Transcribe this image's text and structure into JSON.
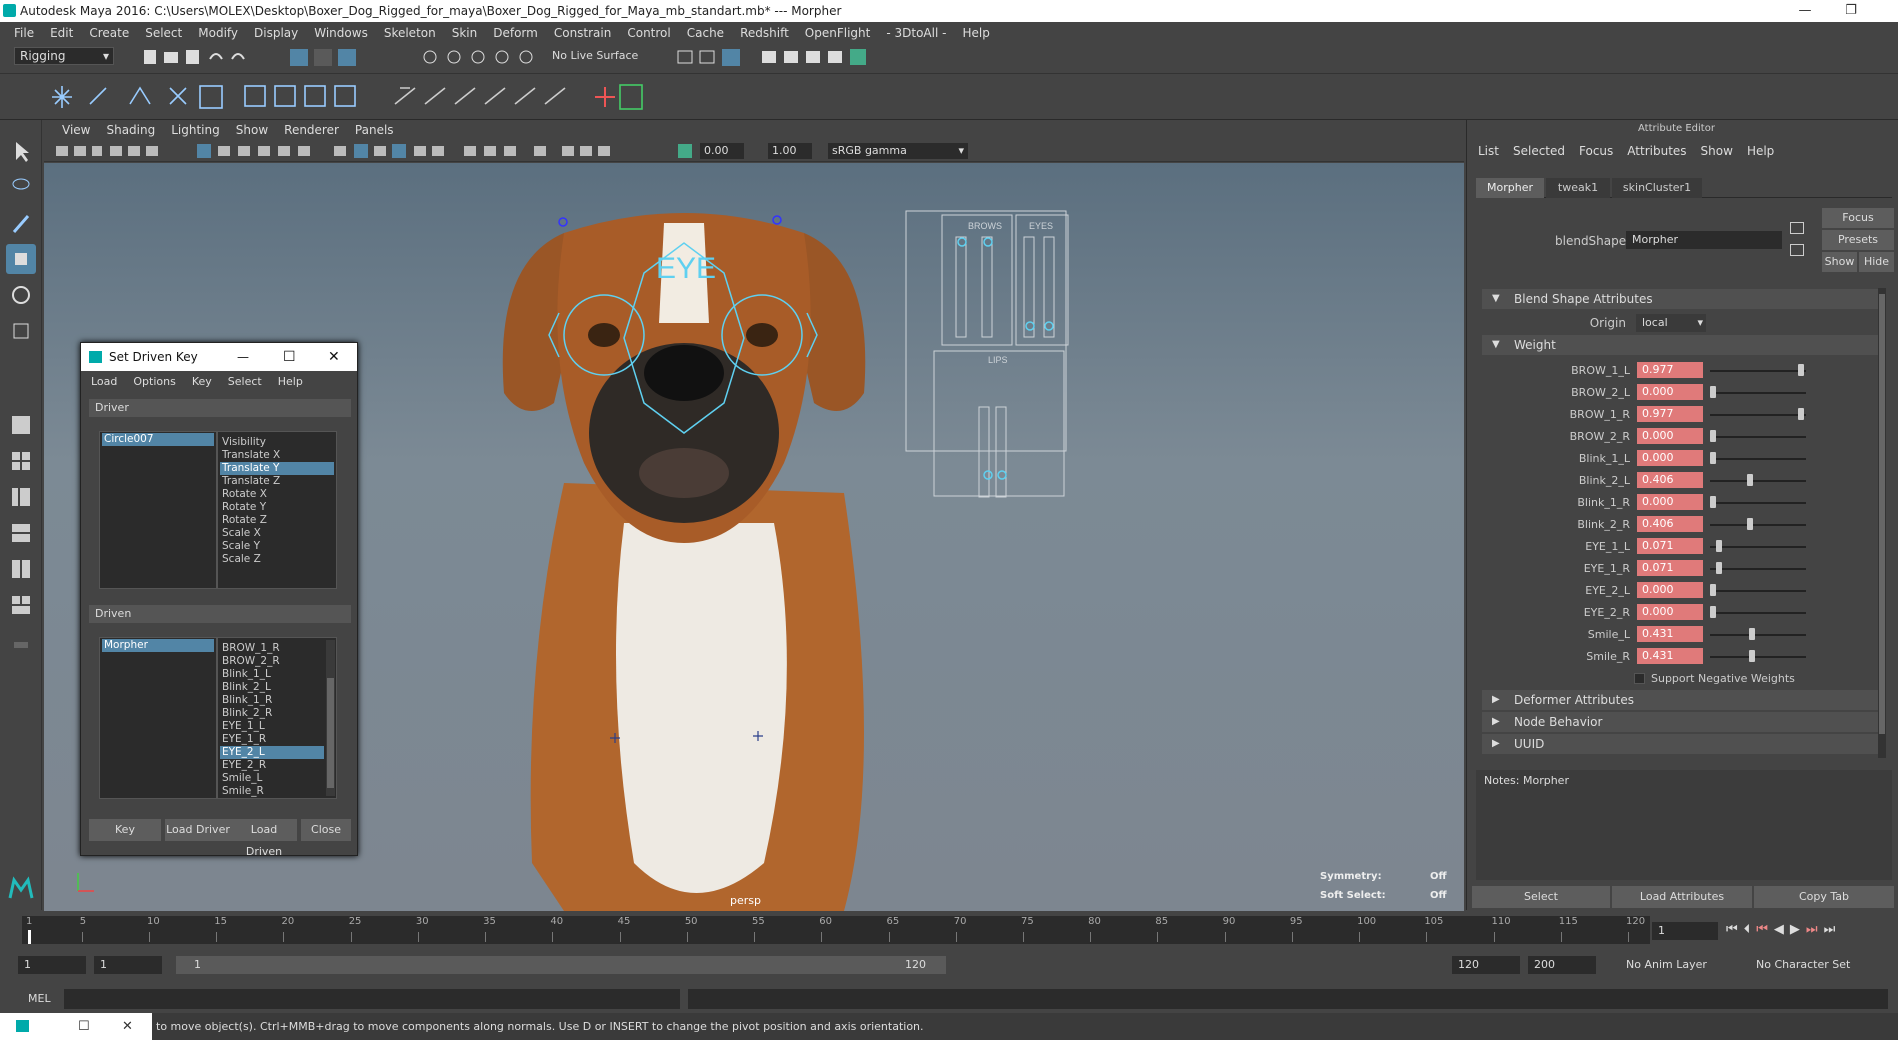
{
  "title_bar": {
    "text": "Autodesk Maya 2016: C:\\Users\\MOLEX\\Desktop\\Boxer_Dog_Rigged_for_maya\\Boxer_Dog_Rigged_for_Maya_mb_standart.mb*  ---  Morpher",
    "minimize": "—",
    "restore": "❐",
    "close": "✕"
  },
  "menubar": [
    "File",
    "Edit",
    "Create",
    "Select",
    "Modify",
    "Display",
    "Windows",
    "Skeleton",
    "Skin",
    "Deform",
    "Constrain",
    "Control",
    "Cache",
    "Redshift",
    "OpenFlight",
    "- 3DtoAll -",
    "Help"
  ],
  "shelf": {
    "mode": "Rigging",
    "live_surface": "No Live Surface"
  },
  "viewport": {
    "menu": [
      "View",
      "Shading",
      "Lighting",
      "Show",
      "Renderer",
      "Panels"
    ],
    "near": "0.00",
    "far": "1.00",
    "color_space": "sRGB gamma",
    "camera": "persp",
    "symmetry_label": "Symmetry:",
    "symmetry_value": "Off",
    "soft_select_label": "Soft Select:",
    "soft_select_value": "Off",
    "eye_control": "EYE",
    "panel_labels": {
      "brows": "BROWS",
      "eyes": "EYES",
      "lips": "LIPS"
    }
  },
  "set_driven_key": {
    "title": "Set Driven Key",
    "menu": [
      "Load",
      "Options",
      "Key",
      "Select",
      "Help"
    ],
    "driver_label": "Driver",
    "driver_object": "Circle007",
    "driver_attrs": [
      "Visibility",
      "Translate X",
      "Translate Y",
      "Translate Z",
      "Rotate X",
      "Rotate Y",
      "Rotate Z",
      "Scale X",
      "Scale Y",
      "Scale Z"
    ],
    "driver_selected": "Translate Y",
    "driven_label": "Driven",
    "driven_object": "Morpher",
    "driven_attrs": [
      "BROW_1_R",
      "BROW_2_R",
      "Blink_1_L",
      "Blink_2_L",
      "Blink_1_R",
      "Blink_2_R",
      "EYE_1_L",
      "EYE_1_R",
      "EYE_2_L",
      "EYE_2_R",
      "Smile_L",
      "Smile_R"
    ],
    "driven_selected": "EYE_2_L",
    "buttons": {
      "key": "Key",
      "load_driver": "Load Driver",
      "load_driven": "Load Driven",
      "close": "Close"
    }
  },
  "attribute_editor": {
    "title": "Attribute Editor",
    "menu": [
      "List",
      "Selected",
      "Focus",
      "Attributes",
      "Show",
      "Help"
    ],
    "tabs": [
      "Morpher",
      "tweak1",
      "skinCluster1"
    ],
    "active_tab": "Morpher",
    "blendshape_label": "blendShape:",
    "blendshape_value": "Morpher",
    "focus_button": "Focus",
    "presets_button": "Presets",
    "show_button": "Show",
    "hide_button": "Hide",
    "section_blend": "Blend Shape Attributes",
    "origin_label": "Origin",
    "origin_value": "local",
    "section_weight": "Weight",
    "weights": [
      {
        "name": "BROW_1_L",
        "value": "0.977",
        "pos": 0.977
      },
      {
        "name": "BROW_2_L",
        "value": "0.000",
        "pos": 0
      },
      {
        "name": "BROW_1_R",
        "value": "0.977",
        "pos": 0.977
      },
      {
        "name": "BROW_2_R",
        "value": "0.000",
        "pos": 0
      },
      {
        "name": "Blink_1_L",
        "value": "0.000",
        "pos": 0
      },
      {
        "name": "Blink_2_L",
        "value": "0.406",
        "pos": 0.406
      },
      {
        "name": "Blink_1_R",
        "value": "0.000",
        "pos": 0
      },
      {
        "name": "Blink_2_R",
        "value": "0.406",
        "pos": 0.406
      },
      {
        "name": "EYE_1_L",
        "value": "0.071",
        "pos": 0.071
      },
      {
        "name": "EYE_1_R",
        "value": "0.071",
        "pos": 0.071
      },
      {
        "name": "EYE_2_L",
        "value": "0.000",
        "pos": 0
      },
      {
        "name": "EYE_2_R",
        "value": "0.000",
        "pos": 0
      },
      {
        "name": "Smile_L",
        "value": "0.431",
        "pos": 0.431
      },
      {
        "name": "Smile_R",
        "value": "0.431",
        "pos": 0.431
      }
    ],
    "support_negative": "Support Negative Weights",
    "sections_collapsed": [
      "Deformer Attributes",
      "Node Behavior",
      "UUID"
    ],
    "notes_label": "Notes:  Morpher",
    "bottom_buttons": [
      "Select",
      "Load Attributes",
      "Copy Tab"
    ]
  },
  "timeline": {
    "ticks": [
      "1",
      "5",
      "10",
      "15",
      "20",
      "25",
      "30",
      "35",
      "40",
      "45",
      "50",
      "55",
      "60",
      "65",
      "70",
      "75",
      "80",
      "85",
      "90",
      "95",
      "100",
      "105",
      "110",
      "115",
      "120"
    ],
    "current_frame": "1"
  },
  "range": {
    "start": "1",
    "inner_start": "1",
    "slider_start": "1",
    "slider_end": "120",
    "end": "120",
    "anim_end": "200",
    "anim_layer": "No Anim Layer",
    "char_set": "No Character Set"
  },
  "command": {
    "label": "MEL"
  },
  "help_line": "to move object(s). Ctrl+MMB+drag to move components along normals. Use D or INSERT to change the pivot position and axis orientation."
}
